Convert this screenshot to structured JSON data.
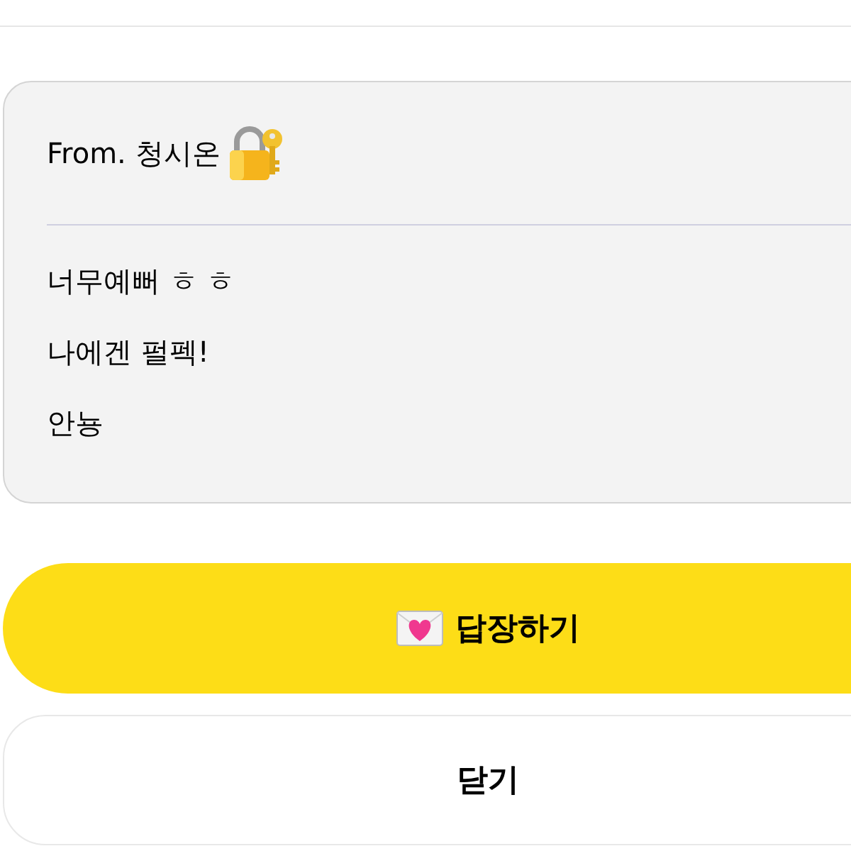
{
  "letter": {
    "sender": "From. 청시온",
    "lines": [
      "너무예뻐 ㅎ ㅎ",
      "나에겐 펄펙!",
      "안뇽"
    ]
  },
  "buttons": [
    {
      "label": "답장하기",
      "kind": "primary"
    },
    {
      "label": "닫기",
      "kind": "secondary"
    }
  ]
}
